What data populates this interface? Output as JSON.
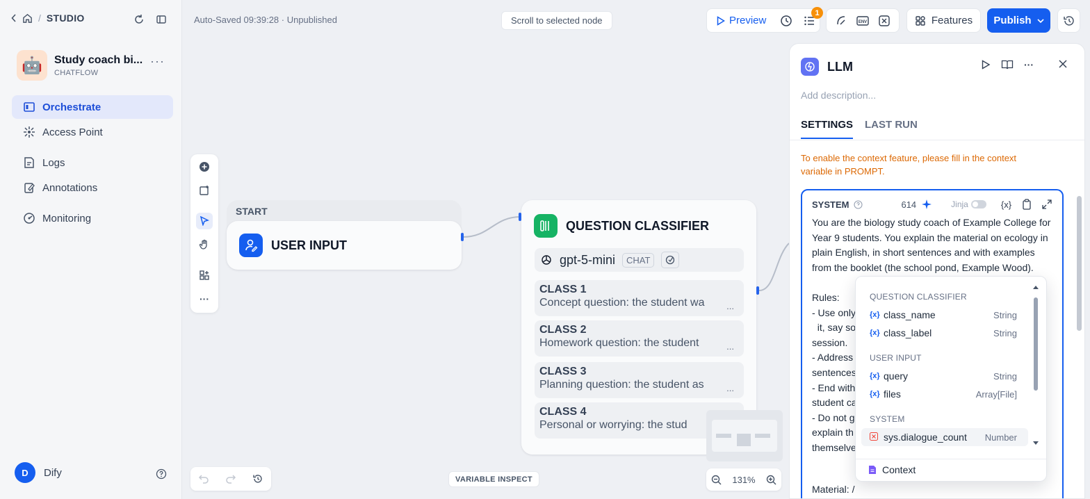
{
  "breadcrumb": {
    "section": "STUDIO",
    "separator": "/"
  },
  "app": {
    "name": "Study coach bi...",
    "type": "CHATFLOW",
    "avatar_emoji": "🤖"
  },
  "nav": [
    {
      "label": "Orchestrate",
      "icon": "orchestrate-icon",
      "active": true
    },
    {
      "label": "Access Point",
      "icon": "access-point-icon"
    },
    {
      "label": "Logs",
      "icon": "logs-icon"
    },
    {
      "label": "Annotations",
      "icon": "annotations-icon"
    },
    {
      "label": "Monitoring",
      "icon": "monitoring-icon"
    }
  ],
  "user": {
    "initial": "D",
    "name": "Dify"
  },
  "topbar": {
    "autosave": "Auto-Saved 09:39:28 · Unpublished",
    "scroll_to_node": "Scroll to selected node",
    "preview": "Preview",
    "checklist_badge": "1",
    "features": "Features",
    "publish": "Publish"
  },
  "nodes": {
    "start": {
      "label": "START",
      "title": "USER INPUT"
    },
    "classifier": {
      "title": "QUESTION CLASSIFIER",
      "model": "gpt-5-mini",
      "model_mode": "CHAT",
      "classes": [
        {
          "title": "CLASS 1",
          "desc": "Concept question: the student wa"
        },
        {
          "title": "CLASS 2",
          "desc": "Homework question: the student"
        },
        {
          "title": "CLASS 3",
          "desc": "Planning question: the student as"
        },
        {
          "title": "CLASS 4",
          "desc": "Personal or worrying: the stud"
        }
      ],
      "ellipsis": "..."
    }
  },
  "canvas": {
    "zoom": "131%",
    "variable_inspect": "VARIABLE INSPECT"
  },
  "panel": {
    "title": "LLM",
    "description_placeholder": "Add description...",
    "tabs": [
      "SETTINGS",
      "LAST RUN"
    ],
    "warning": "To enable the context feature, please fill in the context variable in PROMPT.",
    "system": {
      "label": "SYSTEM",
      "count": "614",
      "jinja": "Jinja",
      "var_button": "{x}",
      "text": "You are the biology study coach of Example College for Year 9 students. You explain the material on ecology in plain English, in short sentences and with examples from the booklet (the school pond, Example Wood).\n\nRules:\n- Use only\n  it, say so\nsession.\n- Address\nsentences\n- End with\nstudent ca\n- Do not g\nexplain th\nthemselve",
      "material": "Material: /"
    }
  },
  "dropdown": {
    "groups": [
      {
        "name": "QUESTION CLASSIFIER",
        "items": [
          {
            "var": "class_name",
            "type": "String"
          },
          {
            "var": "class_label",
            "type": "String"
          }
        ]
      },
      {
        "name": "USER INPUT",
        "items": [
          {
            "var": "query",
            "type": "String"
          },
          {
            "var": "files",
            "type": "Array[File]"
          }
        ]
      },
      {
        "name": "SYSTEM",
        "items": [
          {
            "var": "sys.dialogue_count",
            "type": "Number"
          }
        ]
      }
    ],
    "var_marker": "{x}",
    "context": "Context"
  }
}
